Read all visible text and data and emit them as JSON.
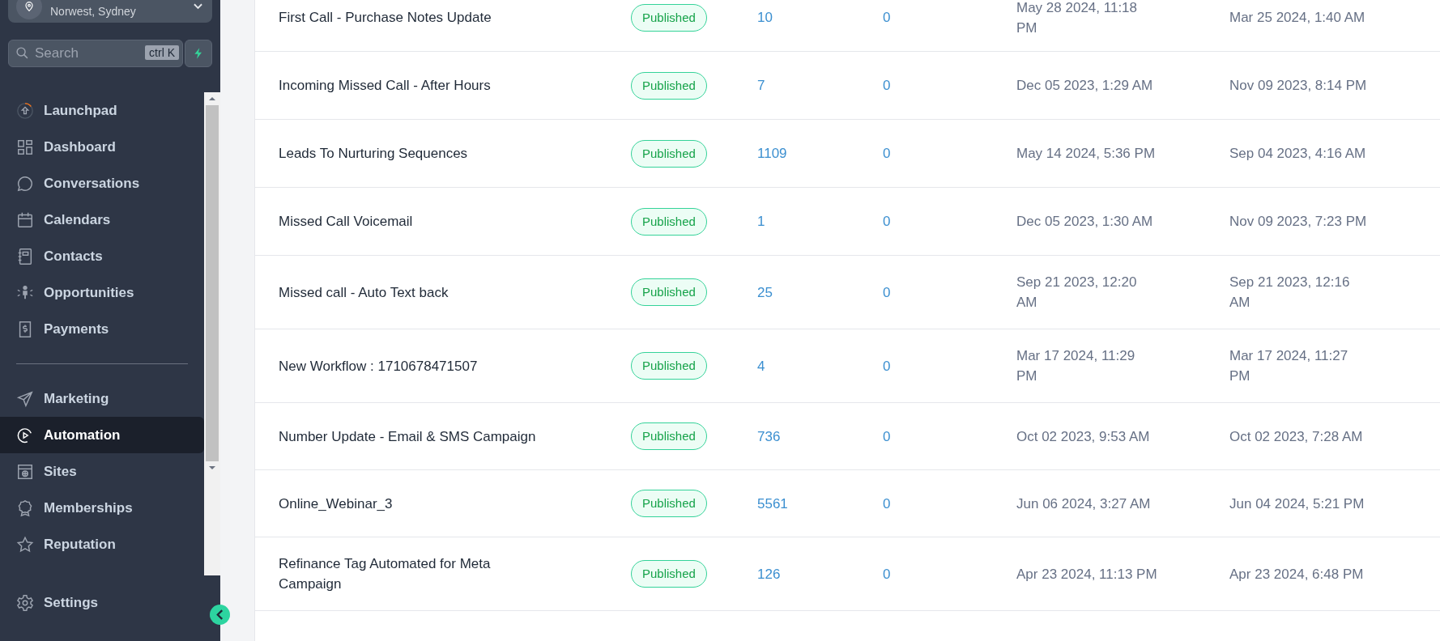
{
  "sidebar": {
    "location": {
      "subtitle": "Norwest, Sydney"
    },
    "search": {
      "placeholder": "Search",
      "shortcut": "ctrl K"
    },
    "nav_groups": [
      [
        {
          "label": "Launchpad",
          "kind": "launchpad",
          "selected": false
        },
        {
          "label": "Dashboard",
          "kind": "dashboard",
          "selected": false
        },
        {
          "label": "Conversations",
          "kind": "chat",
          "selected": false
        },
        {
          "label": "Calendars",
          "kind": "calendar",
          "selected": false
        },
        {
          "label": "Contacts",
          "kind": "contacts",
          "selected": false
        },
        {
          "label": "Opportunities",
          "kind": "people",
          "selected": false
        },
        {
          "label": "Payments",
          "kind": "payments",
          "selected": false
        }
      ],
      [
        {
          "label": "Marketing",
          "kind": "send",
          "selected": false
        },
        {
          "label": "Automation",
          "kind": "automation",
          "selected": true
        },
        {
          "label": "Sites",
          "kind": "sites",
          "selected": false
        },
        {
          "label": "Memberships",
          "kind": "award",
          "selected": false
        },
        {
          "label": "Reputation",
          "kind": "star",
          "selected": false
        }
      ]
    ],
    "footer_item": {
      "label": "Settings",
      "kind": "settings"
    }
  },
  "table": {
    "rows": [
      {
        "name": "First Call - Purchase Notes Update",
        "status": "Published",
        "column_3": "10",
        "column_4": "0",
        "column_5": "May 28 2024, 11:18 PM",
        "column_6": "Mar 25 2024, 1:40 AM"
      },
      {
        "name": "Incoming Missed Call - After Hours",
        "status": "Published",
        "column_3": "7",
        "column_4": "0",
        "column_5": "Dec 05 2023, 1:29 AM",
        "column_6": "Nov 09 2023, 8:14 PM"
      },
      {
        "name": "Leads To Nurturing Sequences",
        "status": "Published",
        "column_3": "1109",
        "column_4": "0",
        "column_5": "May 14 2024, 5:36 PM",
        "column_6": "Sep 04 2023, 4:16 AM"
      },
      {
        "name": "Missed Call Voicemail",
        "status": "Published",
        "column_3": "1",
        "column_4": "0",
        "column_5": "Dec 05 2023, 1:30 AM",
        "column_6": "Nov 09 2023, 7:23 PM"
      },
      {
        "name": "Missed call - Auto Text back",
        "status": "Published",
        "column_3": "25",
        "column_4": "0",
        "column_5": "Sep 21 2023, 12:20 AM",
        "column_6": "Sep 21 2023, 12:16 AM"
      },
      {
        "name": "New Workflow : 1710678471507",
        "status": "Published",
        "column_3": "4",
        "column_4": "0",
        "column_5": "Mar 17 2024, 11:29 PM",
        "column_6": "Mar 17 2024, 11:27 PM"
      },
      {
        "name": "Number Update - Email & SMS Campaign",
        "status": "Published",
        "column_3": "736",
        "column_4": "0",
        "column_5": "Oct 02 2023, 9:53 AM",
        "column_6": "Oct 02 2023, 7:28 AM"
      },
      {
        "name": "Online_Webinar_3",
        "status": "Published",
        "column_3": "5561",
        "column_4": "0",
        "column_5": "Jun 06 2024, 3:27 AM",
        "column_6": "Jun 04 2024, 5:21 PM"
      },
      {
        "name": "Refinance Tag Automated for Meta Campaign",
        "status": "Published",
        "column_3": "126",
        "column_4": "0",
        "column_5": "Apr 23 2024, 11:13 PM",
        "column_6": "Apr 23 2024, 6:48 PM"
      }
    ]
  }
}
